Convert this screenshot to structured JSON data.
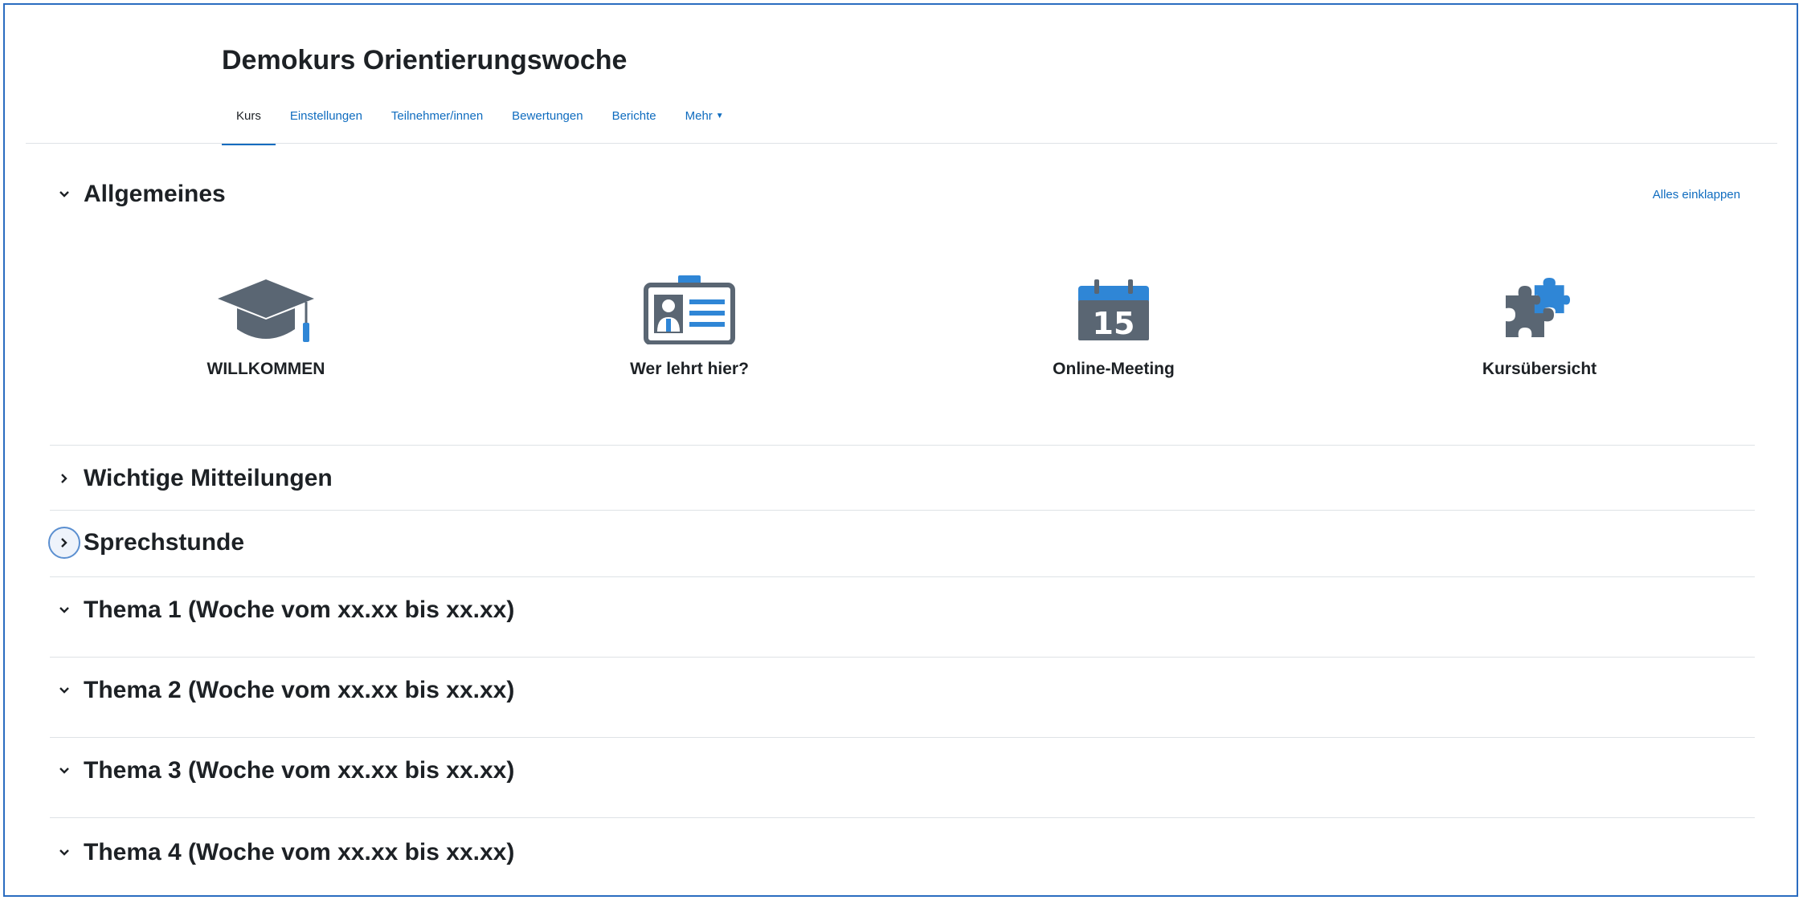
{
  "course": {
    "title": "Demokurs Orientierungswoche"
  },
  "tabs": [
    {
      "label": "Kurs",
      "active": true
    },
    {
      "label": "Einstellungen"
    },
    {
      "label": "Teilnehmer/innen"
    },
    {
      "label": "Bewertungen"
    },
    {
      "label": "Berichte"
    },
    {
      "label": "Mehr"
    }
  ],
  "collapse_all_label": "Alles einklappen",
  "sections": {
    "general": {
      "title": "Allgemeines",
      "state": "expanded"
    },
    "notices": {
      "title": "Wichtige Mitteilungen",
      "state": "collapsed"
    },
    "office_hours": {
      "title": "Sprechstunde",
      "state": "collapsed"
    },
    "topic1": {
      "title": "Thema 1 (Woche vom xx.xx bis xx.xx)",
      "state": "expanded"
    },
    "topic2": {
      "title": "Thema 2 (Woche vom xx.xx bis xx.xx)",
      "state": "expanded"
    },
    "topic3": {
      "title": "Thema 3 (Woche vom xx.xx bis xx.xx)",
      "state": "expanded"
    },
    "topic4": {
      "title": "Thema 4 (Woche vom xx.xx bis xx.xx)",
      "state": "expanded"
    }
  },
  "tiles": [
    {
      "label": "WILLKOMMEN",
      "icon": "graduation-cap-icon"
    },
    {
      "label": "Wer lehrt hier?",
      "icon": "id-badge-icon"
    },
    {
      "label": "Online-Meeting",
      "icon": "calendar-icon",
      "calendar_day": "15"
    },
    {
      "label": "Kursübersicht",
      "icon": "puzzle-icon"
    }
  ],
  "colors": {
    "link": "#0f6cbf",
    "icon_gray": "#5a6673",
    "icon_blue": "#2f86d6",
    "divider": "#dee2e6"
  }
}
